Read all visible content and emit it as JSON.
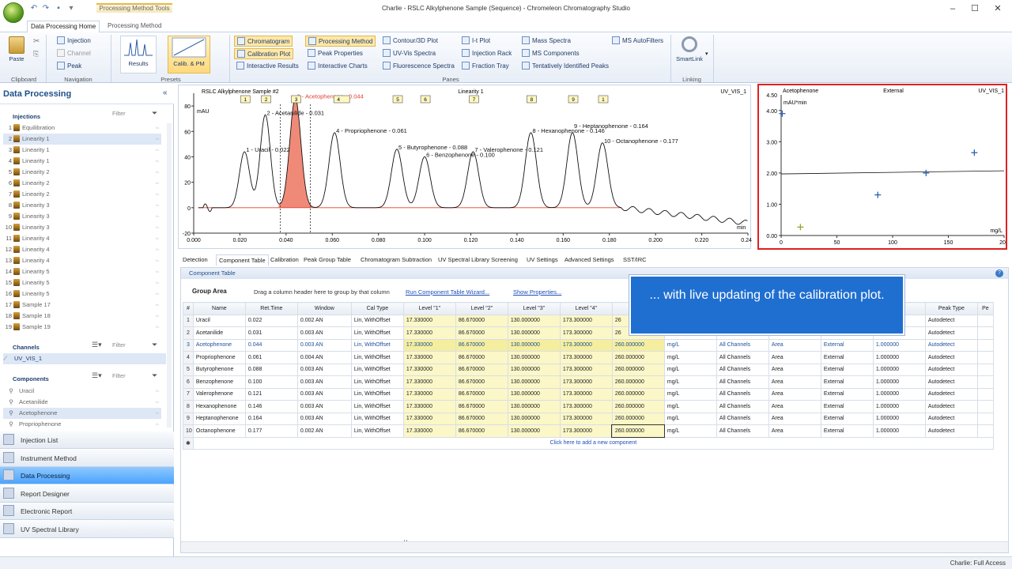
{
  "window": {
    "title": "Charlie - RSLC Alkylphenone Sample (Sequence) - Chromeleon Chromatography Studio",
    "context_tab": "Processing Method Tools",
    "controls": [
      "–",
      "☐",
      "✕"
    ]
  },
  "ribbon": {
    "tabs": [
      "Data Processing Home",
      "Processing Method"
    ],
    "clipboard": {
      "paste": "Paste",
      "label": "Clipboard"
    },
    "navigation": {
      "items": [
        "Injection",
        "Channel",
        "Peak"
      ],
      "label": "Navigation"
    },
    "presets": {
      "results": "Results",
      "calib": "Calib. & PM",
      "label": "Presets"
    },
    "panes": {
      "label": "Panes",
      "col1": [
        "Chromatogram",
        "Calibration Plot",
        "Interactive Results"
      ],
      "col2": [
        "Processing Method",
        "Peak Properties",
        "Interactive Charts"
      ],
      "col3": [
        "Contour/3D Plot",
        "UV-Vis Spectra",
        "Fluorescence Spectra"
      ],
      "col4": [
        "I-t Plot",
        "Injection Rack",
        "Fraction Tray"
      ],
      "col5": [
        "Mass Spectra",
        "MS Components",
        "Tentatively Identified Peaks"
      ],
      "col6": [
        "MS AutoFilters"
      ]
    },
    "linking": {
      "smartlink": "SmartLink",
      "label": "Linking"
    }
  },
  "sidebar": {
    "title": "Data Processing",
    "collapse": "«",
    "injections": {
      "header": "Injections",
      "filter": "Filter",
      "items": [
        {
          "n": "1",
          "name": "Equilibration"
        },
        {
          "n": "2",
          "name": "Linearity 1"
        },
        {
          "n": "3",
          "name": "Linearity 1"
        },
        {
          "n": "4",
          "name": "Linearity 1"
        },
        {
          "n": "5",
          "name": "Linearity 2"
        },
        {
          "n": "6",
          "name": "Linearity 2"
        },
        {
          "n": "7",
          "name": "Linearity 2"
        },
        {
          "n": "8",
          "name": "Linearity 3"
        },
        {
          "n": "9",
          "name": "Linearity 3"
        },
        {
          "n": "10",
          "name": "Linearity 3"
        },
        {
          "n": "11",
          "name": "Linearity 4"
        },
        {
          "n": "12",
          "name": "Linearity 4"
        },
        {
          "n": "13",
          "name": "Linearity 4"
        },
        {
          "n": "14",
          "name": "Linearity 5"
        },
        {
          "n": "15",
          "name": "Linearity 5"
        },
        {
          "n": "16",
          "name": "Linearity 5"
        },
        {
          "n": "17",
          "name": "Sample 17"
        },
        {
          "n": "18",
          "name": "Sample 18"
        },
        {
          "n": "19",
          "name": "Sample 19"
        }
      ]
    },
    "channels": {
      "header": "Channels",
      "filter": "Filter",
      "items": [
        "UV_VIS_1"
      ]
    },
    "components": {
      "header": "Components",
      "filter": "Filter",
      "items": [
        "Uracil",
        "Acetanilide",
        "Acetophenone",
        "Propriophenone"
      ]
    },
    "nav": [
      "Injection List",
      "Instrument Method",
      "Data Processing",
      "Report Designer",
      "Electronic Report",
      "UV Spectral Library"
    ]
  },
  "chromatogram": {
    "title": "RSLC Alkylphenone Sample #2",
    "center_label": "Linearity 1",
    "channel": "UV_VIS_1",
    "ylabel": "mAU",
    "xunit": "min",
    "marker_boxes": [
      "1",
      "2",
      "3",
      "4",
      "5",
      "6",
      "7",
      "8",
      "9",
      "1"
    ]
  },
  "calibration_plot": {
    "left_label": "Acetophenone",
    "mid_label": "External",
    "right_label": "UV_VIS_1",
    "ylabel": "mAU*min",
    "xunit": "mg/L"
  },
  "chart_data": [
    {
      "type": "line",
      "title": "RSLC Alkylphenone Sample #2",
      "xlabel": "min",
      "ylabel": "mAU",
      "xlim": [
        0.0,
        0.24
      ],
      "ylim": [
        -20,
        90
      ],
      "xticks": [
        0.0,
        0.02,
        0.04,
        0.06,
        0.08,
        0.1,
        0.12,
        0.14,
        0.16,
        0.18,
        0.2,
        0.22,
        0.24
      ],
      "xtick_labels": [
        "0.000",
        "0.020",
        "0.040",
        "0.060",
        "0.080",
        "0.100",
        "0.120",
        "0.140",
        "0.160",
        "0.180",
        "0.200",
        "0.220",
        "0.240"
      ],
      "yticks": [
        -20,
        0,
        20,
        40,
        60,
        80
      ],
      "highlight_peak": 3,
      "peaks": [
        {
          "n": 1,
          "label": "1 - Uracil - 0.022",
          "rt": 0.022,
          "height": 44,
          "width": 0.0022
        },
        {
          "n": 2,
          "label": "2 - Acetanilide - 0.031",
          "rt": 0.031,
          "height": 73,
          "width": 0.0022
        },
        {
          "n": 3,
          "label": "3 - Acetophenone - 0.044",
          "rt": 0.044,
          "height": 86,
          "width": 0.0024
        },
        {
          "n": 4,
          "label": "4 - Propriophenone - 0.061",
          "rt": 0.061,
          "height": 59,
          "width": 0.0024
        },
        {
          "n": 5,
          "label": "5 - Butyrophenone - 0.088",
          "rt": 0.088,
          "height": 46,
          "width": 0.0024
        },
        {
          "n": 6,
          "label": "6 - Benzophenone - 0.100",
          "rt": 0.1,
          "height": 40,
          "width": 0.0024
        },
        {
          "n": 7,
          "label": "7 - Valerophenone - 0.121",
          "rt": 0.121,
          "height": 44,
          "width": 0.0024
        },
        {
          "n": 8,
          "label": "8 - Hexanophenone - 0.146",
          "rt": 0.146,
          "height": 59,
          "width": 0.0024
        },
        {
          "n": 9,
          "label": "9 - Heptanophenone - 0.164",
          "rt": 0.164,
          "height": 59,
          "width": 0.0024
        },
        {
          "n": 10,
          "label": "10 - Octanophenone - 0.177",
          "rt": 0.177,
          "height": 51,
          "width": 0.0024
        }
      ]
    },
    {
      "type": "scatter",
      "title": "Acetophenone",
      "xlabel": "mg/L",
      "ylabel": "mAU*min",
      "xlim": [
        0,
        200
      ],
      "ylim": [
        0,
        4.5
      ],
      "xticks": [
        0,
        50,
        100,
        150,
        200
      ],
      "yticks": [
        0.0,
        1.0,
        2.0,
        3.0,
        4.0
      ],
      "ytick_labels": [
        "0.00",
        "1.00",
        "2.00",
        "3.00",
        "4.00",
        "4.50"
      ],
      "points": [
        {
          "x": 17.3,
          "y": 0.27,
          "color": "#9aa12a"
        },
        {
          "x": 86.7,
          "y": 1.3,
          "color": "#2a62b5"
        },
        {
          "x": 130.0,
          "y": 2.0,
          "color": "#2a62b5"
        },
        {
          "x": 173.3,
          "y": 2.65,
          "color": "#2a62b5"
        },
        {
          "x": 1.0,
          "y": 3.9,
          "color": "#2a62b5"
        }
      ],
      "fit_line": [
        {
          "x": 0,
          "y": 1.97
        },
        {
          "x": 200,
          "y": 2.07
        }
      ]
    }
  ],
  "bottom_tabs": [
    "Detection",
    "Component Table",
    "Calibration",
    "Peak Group Table",
    "Chromatogram Subtraction",
    "UV Spectral Library Screening",
    "UV Settings",
    "Advanced Settings",
    "SST/IRC"
  ],
  "component_table": {
    "header": "Component Table",
    "group_area": "Group Area",
    "group_hint": "Drag a column header here to group by that column",
    "wizard_link": "Run Component Table Wizard...",
    "props_link": "Show Properties...",
    "columns": [
      "#",
      "Name",
      "Ret.Time",
      "Window",
      "Cal Type",
      "Level \"1\"",
      "Level \"2\"",
      "Level \"3\"",
      "Level \"4\"",
      "",
      "",
      "",
      "",
      "",
      "actor",
      "Peak Type",
      "Pe"
    ],
    "rows": [
      [
        "1",
        "Uracil",
        "0.022",
        "0.002 AN",
        "Lin, WithOffset",
        "17.330000",
        "86.670000",
        "130.000000",
        "173.300000",
        "26",
        "",
        "",
        "",
        "",
        "0",
        "Autodetect",
        ""
      ],
      [
        "2",
        "Acetanilide",
        "0.031",
        "0.003 AN",
        "Lin, WithOffset",
        "17.330000",
        "86.670000",
        "130.000000",
        "173.300000",
        "26",
        "",
        "",
        "",
        "",
        "0",
        "Autodetect",
        ""
      ],
      [
        "3",
        "Acetophenone",
        "0.044",
        "0.003 AN",
        "Lin, WithOffset",
        "17.330000",
        "86.670000",
        "130.000000",
        "173.300000",
        "260.000000",
        "mg/L",
        "All Channels",
        "Area",
        "External",
        "1.000000",
        "Autodetect",
        ""
      ],
      [
        "4",
        "Propriophenone",
        "0.061",
        "0.004 AN",
        "Lin, WithOffset",
        "17.330000",
        "86.670000",
        "130.000000",
        "173.300000",
        "260.000000",
        "mg/L",
        "All Channels",
        "Area",
        "External",
        "1.000000",
        "Autodetect",
        ""
      ],
      [
        "5",
        "Butyrophenone",
        "0.088",
        "0.003 AN",
        "Lin, WithOffset",
        "17.330000",
        "86.670000",
        "130.000000",
        "173.300000",
        "260.000000",
        "mg/L",
        "All Channels",
        "Area",
        "External",
        "1.000000",
        "Autodetect",
        ""
      ],
      [
        "6",
        "Benzophenone",
        "0.100",
        "0.003 AN",
        "Lin, WithOffset",
        "17.330000",
        "86.670000",
        "130.000000",
        "173.300000",
        "260.000000",
        "mg/L",
        "All Channels",
        "Area",
        "External",
        "1.000000",
        "Autodetect",
        ""
      ],
      [
        "7",
        "Valerophenone",
        "0.121",
        "0.003 AN",
        "Lin, WithOffset",
        "17.330000",
        "86.670000",
        "130.000000",
        "173.300000",
        "260.000000",
        "mg/L",
        "All Channels",
        "Area",
        "External",
        "1.000000",
        "Autodetect",
        ""
      ],
      [
        "8",
        "Hexanophenone",
        "0.146",
        "0.003 AN",
        "Lin, WithOffset",
        "17.330000",
        "86.670000",
        "130.000000",
        "173.300000",
        "260.000000",
        "mg/L",
        "All Channels",
        "Area",
        "External",
        "1.000000",
        "Autodetect",
        ""
      ],
      [
        "9",
        "Heptanophenone",
        "0.164",
        "0.003 AN",
        "Lin, WithOffset",
        "17.330000",
        "86.670000",
        "130.000000",
        "173.300000",
        "260.000000",
        "mg/L",
        "All Channels",
        "Area",
        "External",
        "1.000000",
        "Autodetect",
        ""
      ],
      [
        "10",
        "Octanophenone",
        "0.177",
        "0.002 AN",
        "Lin, WithOffset",
        "17.330000",
        "86.670000",
        "130.000000",
        "173.300000",
        "260.000000",
        "mg/L",
        "All Channels",
        "Area",
        "External",
        "1.000000",
        "Autodetect",
        ""
      ]
    ],
    "add_row": "Click here to add a new component",
    "new_row_marker": "✱"
  },
  "tooltip": "... with live updating of the calibration plot.",
  "status": {
    "user": "Charlie: Full Access"
  },
  "colors": {
    "accent": "#1f6fd1",
    "highlight_peak": "#f08a78",
    "cal_border": "#e02020",
    "nav_active": "#4aa3ff"
  }
}
